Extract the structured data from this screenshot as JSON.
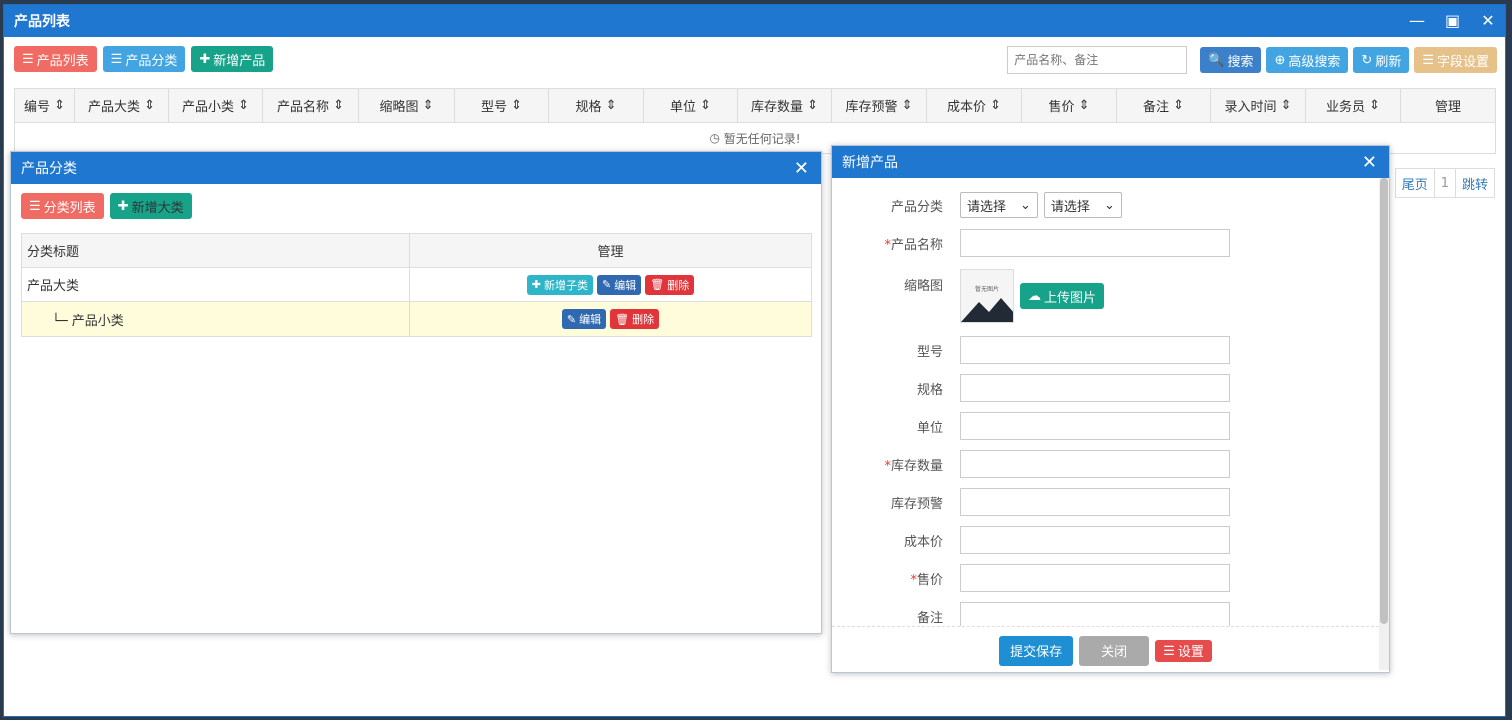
{
  "main": {
    "title": "产品列表",
    "toolbar": {
      "product_list": "产品列表",
      "product_category": "产品分类",
      "add_product": "新增产品"
    },
    "search": {
      "placeholder": "产品名称、备注",
      "search": "搜索",
      "advanced": "高级搜索",
      "refresh": "刷新",
      "fields": "字段设置"
    },
    "columns": [
      "编号",
      "产品大类",
      "产品小类",
      "产品名称",
      "缩略图",
      "型号",
      "规格",
      "单位",
      "库存数量",
      "库存预警",
      "成本价",
      "售价",
      "备注",
      "录入时间",
      "业务员",
      "管理"
    ],
    "empty": "暂无任何记录!",
    "pager": {
      "last": "尾页",
      "page": "1",
      "jump": "跳转"
    }
  },
  "category_dialog": {
    "title": "产品分类",
    "list_btn": "分类列表",
    "add_btn": "新增大类",
    "headers": {
      "title": "分类标题",
      "manage": "管理"
    },
    "rows": [
      {
        "title": "产品大类",
        "add_child": "新增子类",
        "edit": "编辑",
        "delete": "删除"
      },
      {
        "title": "└─ 产品小类",
        "edit": "编辑",
        "delete": "删除"
      }
    ]
  },
  "add_dialog": {
    "title": "新增产品",
    "fields": {
      "category": "产品分类",
      "select1": "请选择",
      "select2": "请选择",
      "name": "产品名称",
      "thumb": "缩略图",
      "thumb_placeholder": "暂无图片",
      "upload": "上传图片",
      "model": "型号",
      "spec": "规格",
      "unit": "单位",
      "stock": "库存数量",
      "stock_warn": "库存预警",
      "cost": "成本价",
      "price": "售价",
      "remark": "备注"
    },
    "footer": {
      "submit": "提交保存",
      "close": "关闭",
      "settings": "设置"
    }
  },
  "colors": {
    "title_bar": "#1f77d0",
    "red": "#ef6b63",
    "teal": "#16a38a",
    "light_blue": "#42a5e2"
  }
}
